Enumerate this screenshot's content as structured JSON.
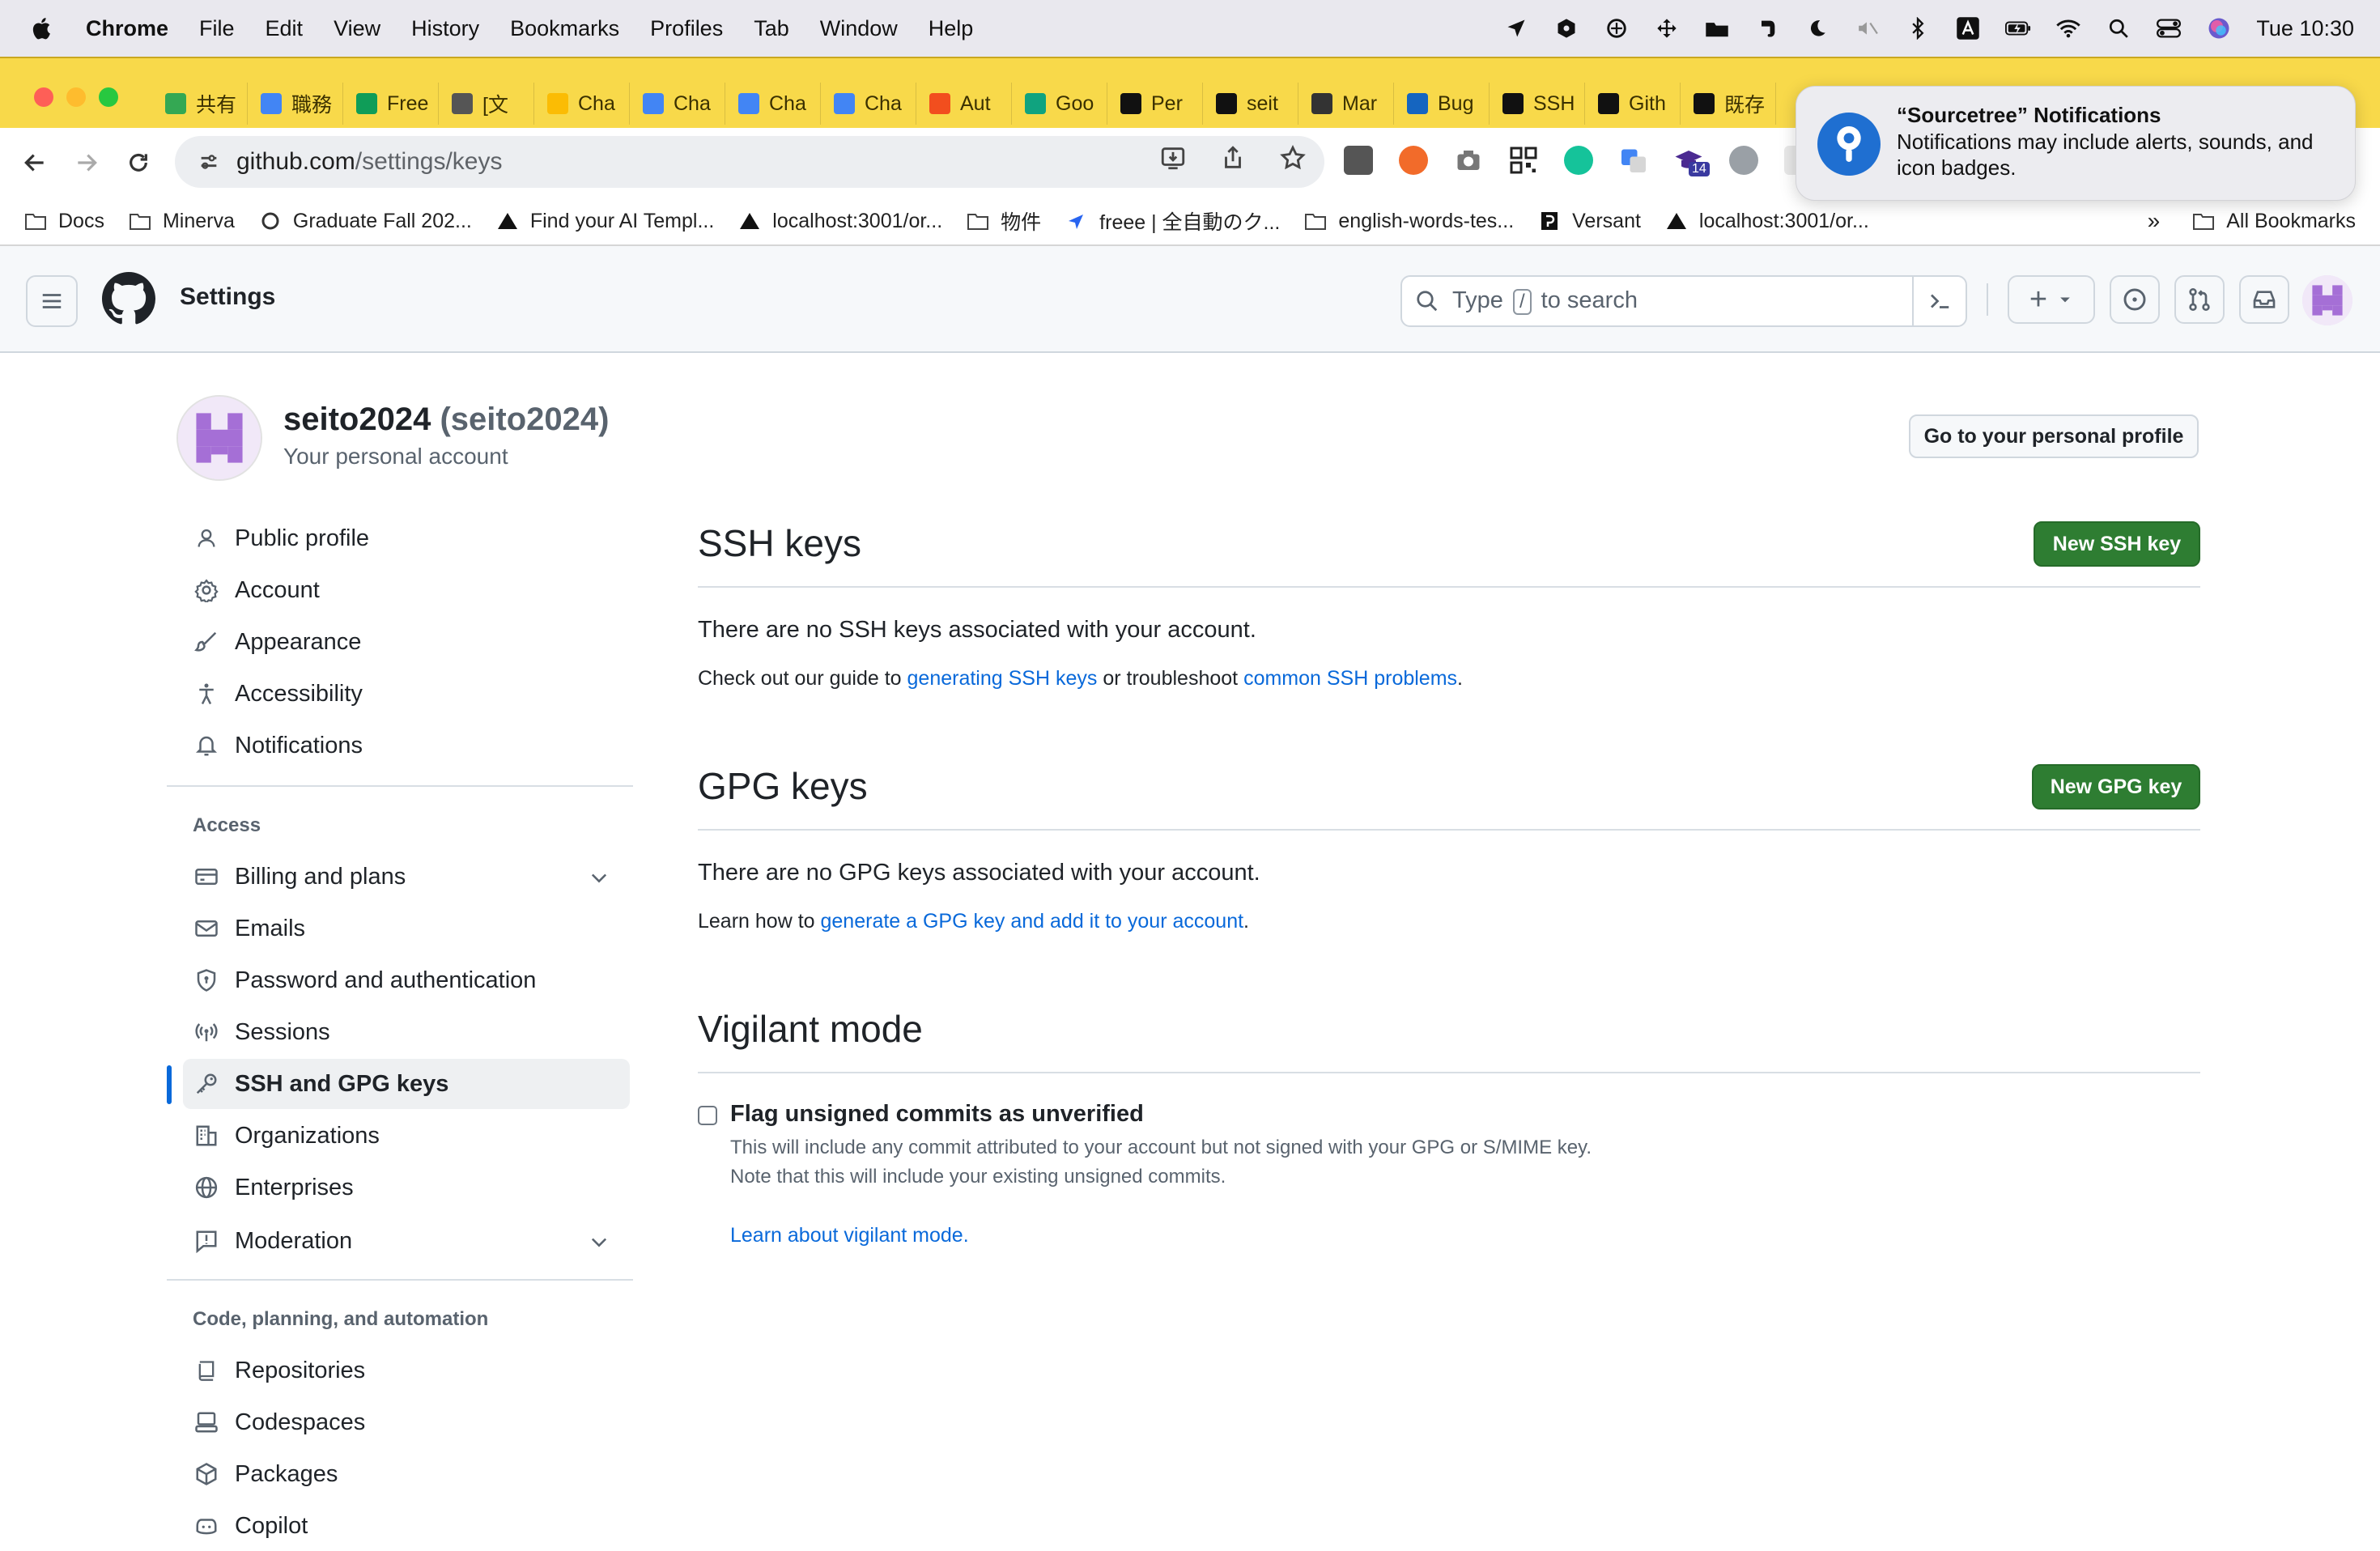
{
  "menubar": {
    "app": "Chrome",
    "items": [
      "File",
      "Edit",
      "View",
      "History",
      "Bookmarks",
      "Profiles",
      "Tab",
      "Window",
      "Help"
    ],
    "clock": "Tue 10:30"
  },
  "tabs": [
    {
      "label": "共有",
      "color": "#34a853"
    },
    {
      "label": "職務",
      "color": "#4285f4"
    },
    {
      "label": "Free",
      "color": "#0f9d58"
    },
    {
      "label": "[文",
      "color": "#555555"
    },
    {
      "label": "Cha",
      "color": "#fbbc04"
    },
    {
      "label": "Cha",
      "color": "#4285f4"
    },
    {
      "label": "Cha",
      "color": "#4285f4"
    },
    {
      "label": "Cha",
      "color": "#4285f4"
    },
    {
      "label": "Aut",
      "color": "#f24e1e"
    },
    {
      "label": "Goo",
      "color": "#10a37f"
    },
    {
      "label": "Per",
      "color": "#111111"
    },
    {
      "label": "seit",
      "color": "#111111"
    },
    {
      "label": "Mar",
      "color": "#333333"
    },
    {
      "label": "Bug",
      "color": "#1565c0"
    },
    {
      "label": "SSH",
      "color": "#111111"
    },
    {
      "label": "Gith",
      "color": "#111111"
    },
    {
      "label": "既存",
      "color": "#111111"
    }
  ],
  "address": {
    "host": "github.com",
    "path": "/settings/keys"
  },
  "bookmarks": [
    {
      "label": "Docs",
      "icon": "folder-icon"
    },
    {
      "label": "Minerva",
      "icon": "folder-icon"
    },
    {
      "label": "Graduate Fall 202...",
      "icon": "circle-icon"
    },
    {
      "label": "Find your AI Templ...",
      "icon": "triangle-icon"
    },
    {
      "label": "localhost:3001/or...",
      "icon": "triangle-icon"
    },
    {
      "label": "物件",
      "icon": "folder-icon"
    },
    {
      "label": "freee | 全自動のク...",
      "icon": "freee-icon"
    },
    {
      "label": "english-words-tes...",
      "icon": "folder-icon"
    },
    {
      "label": "Versant",
      "icon": "versant-icon"
    },
    {
      "label": "localhost:3001/or...",
      "icon": "triangle-icon"
    }
  ],
  "bookmarks_more": "»",
  "bookmarks_all": "All Bookmarks",
  "notification": {
    "title": "“Sourcetree” Notifications",
    "body": "Notifications may include alerts, sounds, and icon badges."
  },
  "extension_badge": "14",
  "header": {
    "context": "Settings",
    "search_placeholder_before": "Type",
    "search_slash": "/",
    "search_placeholder_after": "to search",
    "plus": "+"
  },
  "profile": {
    "name": "seito2024",
    "login": "(seito2024)",
    "subtitle": "Your personal account",
    "go_profile": "Go to your personal profile"
  },
  "sidebar": {
    "items_top": [
      {
        "label": "Public profile",
        "icon": "person-icon"
      },
      {
        "label": "Account",
        "icon": "gear-icon"
      },
      {
        "label": "Appearance",
        "icon": "paintbrush-icon"
      },
      {
        "label": "Accessibility",
        "icon": "accessibility-icon"
      },
      {
        "label": "Notifications",
        "icon": "bell-icon"
      }
    ],
    "access_heading": "Access",
    "items_access": [
      {
        "label": "Billing and plans",
        "icon": "credit-card-icon"
      },
      {
        "label": "Emails",
        "icon": "mail-icon"
      },
      {
        "label": "Password and authentication",
        "icon": "shield-lock-icon"
      },
      {
        "label": "Sessions",
        "icon": "broadcast-icon"
      },
      {
        "label": "SSH and GPG keys",
        "icon": "key-icon"
      },
      {
        "label": "Organizations",
        "icon": "organization-icon"
      },
      {
        "label": "Enterprises",
        "icon": "globe-icon"
      },
      {
        "label": "Moderation",
        "icon": "report-icon"
      }
    ],
    "code_heading": "Code, planning, and automation",
    "items_code": [
      {
        "label": "Repositories",
        "icon": "repo-icon"
      },
      {
        "label": "Codespaces",
        "icon": "codespaces-icon"
      },
      {
        "label": "Packages",
        "icon": "package-icon"
      },
      {
        "label": "Copilot",
        "icon": "copilot-icon"
      }
    ]
  },
  "ssh": {
    "title": "SSH keys",
    "button": "New SSH key",
    "empty": "There are no SSH keys associated with your account.",
    "guide_before": "Check out our guide to",
    "guide_link1": "generating SSH keys",
    "guide_middle": "or troubleshoot",
    "guide_link2": "common SSH problems",
    "guide_after": "."
  },
  "gpg": {
    "title": "GPG keys",
    "button": "New GPG key",
    "empty": "There are no GPG keys associated with your account.",
    "learn_before": "Learn how to",
    "learn_link": "generate a GPG key and add it to your account",
    "learn_after": "."
  },
  "vigilant": {
    "title": "Vigilant mode",
    "checkbox_label": "Flag unsigned commits as unverified",
    "note_line1": "This will include any commit attributed to your account but not signed with your GPG or S/MIME key.",
    "note_line2": "Note that this will include your existing unsigned commits.",
    "learn_link": "Learn about vigilant mode.",
    "checked": false
  },
  "colors": {
    "accent": "#0969da",
    "primary_button": "#2e7d32",
    "tabstrip": "#f8d94a",
    "avatar": "#a56fd6"
  }
}
